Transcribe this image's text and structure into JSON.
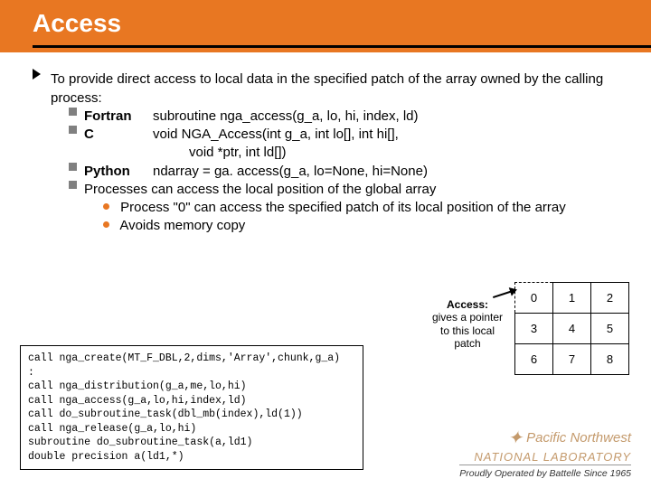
{
  "title": "Access",
  "main": "To provide direct access to local data in the specified patch of the array owned by the calling process:",
  "langs": {
    "fortran_label": "Fortran",
    "fortran_sig": "subroutine nga_access(g_a, lo, hi, index, ld)",
    "c_label": "C",
    "c_sig1": "void NGA_Access(int g_a, int lo[], int hi[],",
    "c_sig2": "void *ptr, int ld[])",
    "python_label": "Python",
    "python_sig": "ndarray = ga. access(g_a, lo=None, hi=None)"
  },
  "proc_line": "Processes can access the local position of the global array",
  "proc_sub1": "Process \"0\" can access the specified patch of its local position of the array",
  "proc_sub2": "Avoids memory copy",
  "access_note": {
    "bold": "Access:",
    "rest": "gives a pointer to this local patch"
  },
  "grid": [
    [
      "0",
      "1",
      "2"
    ],
    [
      "3",
      "4",
      "5"
    ],
    [
      "6",
      "7",
      "8"
    ]
  ],
  "code": [
    "call nga_create(MT_F_DBL,2,dims,'Array',chunk,g_a)",
    "   :",
    "call nga_distribution(g_a,me,lo,hi)",
    "call nga_access(g_a,lo,hi,index,ld)",
    "call do_subroutine_task(dbl_mb(index),ld(1))",
    "call nga_release(g_a,lo,hi)",
    "subroutine do_subroutine_task(a,ld1)",
    "double precision a(ld1,*)"
  ],
  "footer": {
    "lab1": "Pacific Northwest",
    "lab2": "NATIONAL LABORATORY",
    "battelle": "Proudly Operated by Battelle Since 1965"
  }
}
